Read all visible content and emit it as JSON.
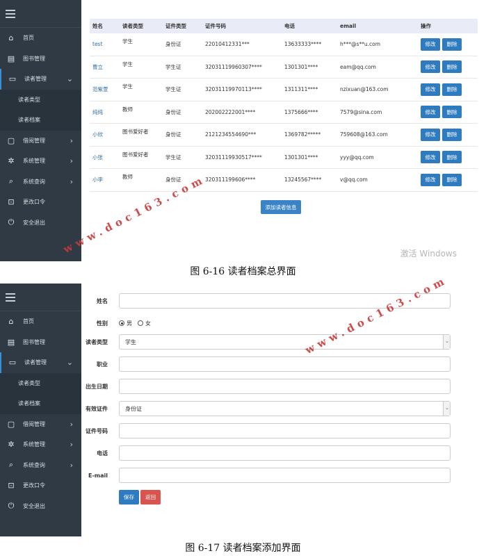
{
  "sidebar_items": [
    "首页",
    "图书管理",
    "读者管理",
    "借阅管理",
    "系统管理",
    "系统查询",
    "更改口令",
    "安全退出"
  ],
  "sidebar_subitems": [
    "读者类型",
    "读者档案"
  ],
  "table1": {
    "headers": [
      "姓名",
      "读者类型",
      "证件类型",
      "证件号码",
      "电话",
      "email",
      "操作"
    ],
    "rows": [
      [
        "test",
        "学生",
        "身份证",
        "22010412331***",
        "13633333****",
        "h***@s**u.com"
      ],
      [
        "曹立",
        "学生",
        "学生证",
        "32031119960307****",
        "1301301****",
        "eam@qq.com"
      ],
      [
        "范紫萱",
        "学生",
        "学生证",
        "32031119970113****",
        "1311311****",
        "nzixuan@163.com"
      ],
      [
        "纯纯",
        "教师",
        "身份证",
        "202002222001****",
        "1375666****",
        "7579@sina.com"
      ],
      [
        "小欣",
        "图书爱好者",
        "身份证",
        "2121234554690***",
        "1369782*****",
        "759608@163.com"
      ],
      [
        "小张",
        "图书爱好者",
        "学生证",
        "32031119930517****",
        "1301301****",
        "yyy@qq.com"
      ],
      [
        "小李",
        "教师",
        "身份证",
        "320311199606****",
        "13245567****",
        "v@qq.com"
      ]
    ],
    "edit_label": "修改",
    "delete_label": "删除",
    "add_label": "添加读者信息",
    "watermark": "激活 Windows"
  },
  "caption1": "图 6-16  读者档案总界面",
  "form": {
    "name_label": "姓名",
    "gender_label": "性别",
    "gender_male": "男",
    "gender_female": "女",
    "reader_type_label": "读者类型",
    "reader_type_value": "学生",
    "job_label": "职业",
    "birth_label": "出生日期",
    "id_type_label": "有效证件",
    "id_type_value": "身份证",
    "id_no_label": "证件号码",
    "phone_label": "电话",
    "email_label": "E-mail",
    "save_label": "保存",
    "back_label": "返回"
  },
  "caption2": "图 6-17  读者档案添加界面",
  "stamp_text": "www.doc163.com",
  "colors": {
    "sidebar": "#2f3a44",
    "primary": "#2f7bc0",
    "danger": "#d9534f",
    "stamp": "#c83a3a"
  }
}
